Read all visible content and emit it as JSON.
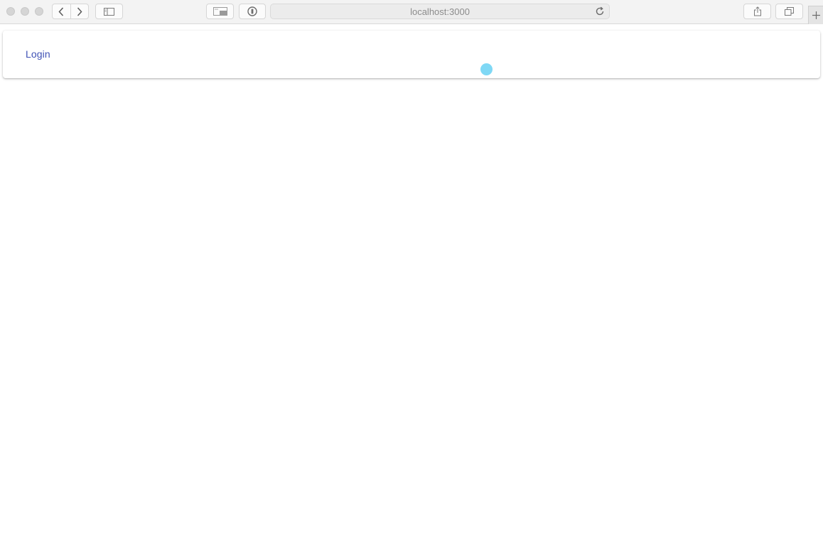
{
  "browser": {
    "address": "localhost:3000",
    "icons": {
      "back": "chevron-left-icon",
      "forward": "chevron-right-icon",
      "sidebar": "sidebar-icon",
      "reader": "reader-icon",
      "privacy": "privacy-report-icon",
      "reload": "reload-icon",
      "share": "share-icon",
      "tabs": "tabs-overview-icon",
      "new_tab": "plus-icon"
    }
  },
  "app_bar": {
    "login_label": "Login",
    "accent_color": "#3f51b5"
  },
  "cursor": {
    "color": "#7fd8f5"
  }
}
